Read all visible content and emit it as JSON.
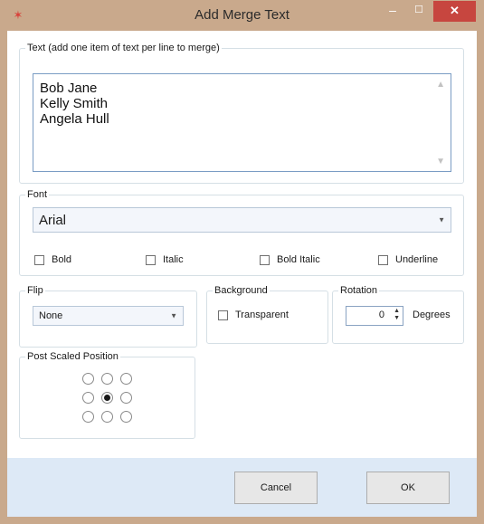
{
  "window": {
    "title": "Add Merge Text",
    "minimize": "–",
    "maximize": "☐",
    "close": "✕",
    "accent_close": "#c7463f"
  },
  "text_group": {
    "label": "Text (add one item of text per line to merge)",
    "lines": [
      "Bob Jane",
      "Kelly Smith",
      "Angela Hull"
    ]
  },
  "font_group": {
    "label": "Font",
    "font_value": "Arial",
    "bold": "Bold",
    "italic": "Italic",
    "bold_italic": "Bold Italic",
    "underline": "Underline"
  },
  "flip_group": {
    "label": "Flip",
    "value": "None"
  },
  "background_group": {
    "label": "Background",
    "transparent": "Transparent"
  },
  "rotation_group": {
    "label": "Rotation",
    "value": "0",
    "unit": "Degrees"
  },
  "position_group": {
    "label": "Post Scaled Position",
    "selected": "middle-center"
  },
  "buttons": {
    "cancel": "Cancel",
    "ok": "OK"
  }
}
